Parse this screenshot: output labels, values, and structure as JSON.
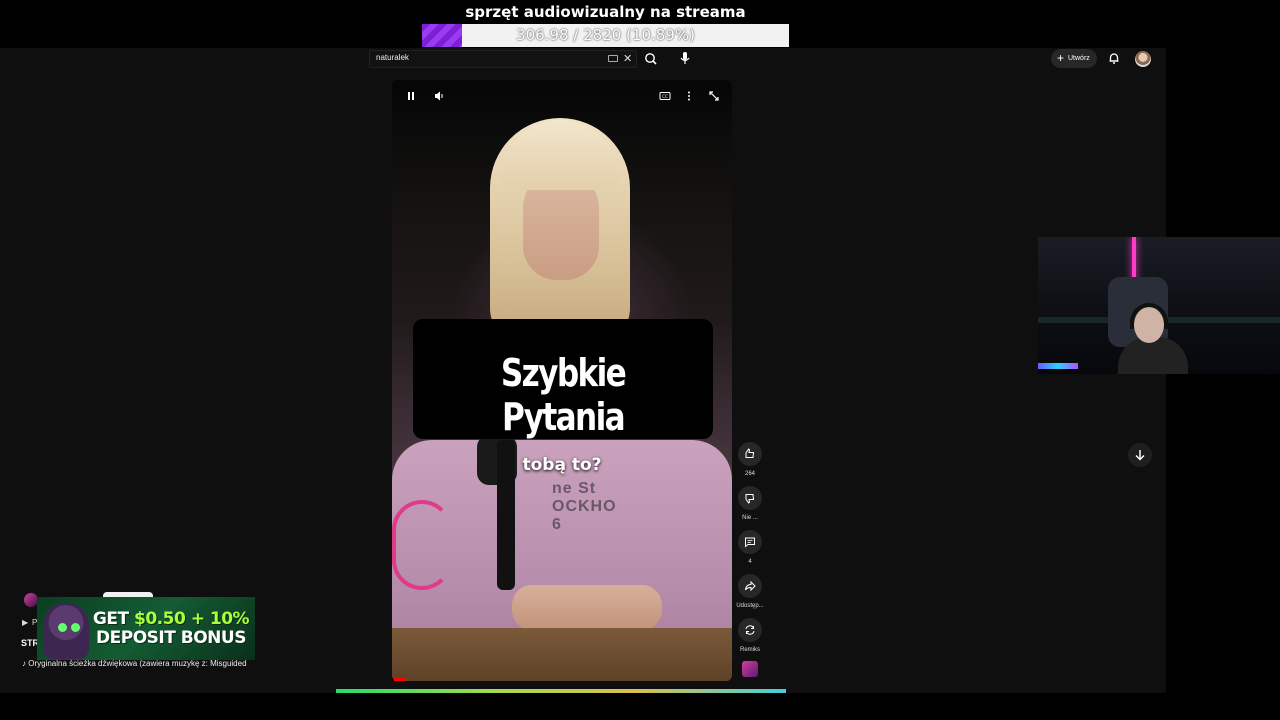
{
  "overlay": {
    "title": "sprzęt audiowizualny na streama",
    "progress_text": "306.98 / 2820 (10.89%)",
    "progress_fraction": 0.1089
  },
  "header": {
    "search_value": "naturalek",
    "create_label": "Utwórz"
  },
  "video": {
    "title_card": "Szybkie Pytania",
    "caption": "tobą to?",
    "sweater_text": "ne St\nOCKHO\n6"
  },
  "actions": {
    "like_count": "264",
    "dislike_label": "Nie ...",
    "comments_count": "4",
    "share_label": "Udostęp...",
    "remix_label": "Remiks"
  },
  "short_info": {
    "play_label": "P",
    "title": "STR",
    "audio": "♪ Oryginalna ścieżka dźwiękowa (zawiera muzykę z: Misguided"
  },
  "ad": {
    "line1_prefix": "GET ",
    "line1_accent": "$0.50 + 10%",
    "line2": "DEPOSIT BONUS"
  },
  "icons": {
    "pause": "pause-icon",
    "volume": "volume-icon",
    "captions": "captions-icon",
    "more": "more-vert-icon",
    "fullscreen": "fullscreen-icon",
    "search": "search-icon",
    "mic": "mic-icon",
    "bell": "bell-icon",
    "like": "thumb-up-icon",
    "dislike": "thumb-down-icon",
    "comment": "comment-icon",
    "share": "share-icon",
    "remix": "remix-icon",
    "scroll": "arrow-down-icon"
  },
  "colors": {
    "progress_purple": "#7c1fd6",
    "yt_red": "#ff0000",
    "background": "#0f0f0f"
  }
}
